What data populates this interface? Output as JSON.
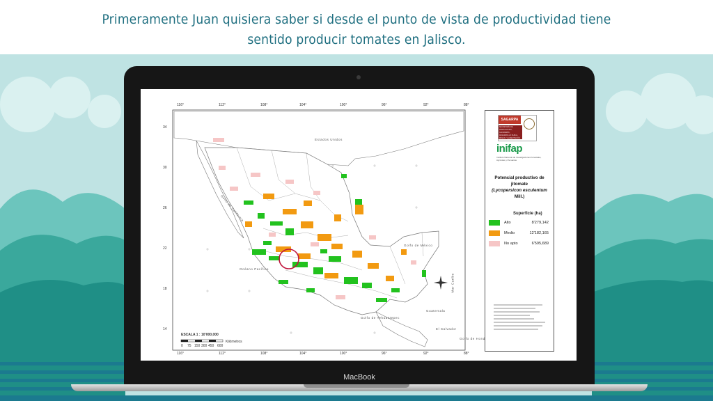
{
  "header": {
    "text": "Primeramente Juan quisiera saber si desde el punto de vista de productividad tiene sentido producir tomates en Jalisco."
  },
  "laptop": {
    "brand": "MacBook"
  },
  "map": {
    "longitudes": [
      "116°",
      "112°",
      "108°",
      "104°",
      "100°",
      "96°",
      "92°",
      "88°"
    ],
    "latitudes": [
      "34",
      "30",
      "26",
      "22",
      "18",
      "14"
    ],
    "labels": {
      "usa": "Estados Unidos",
      "gulf_mexico": "Golfo de México",
      "pacific": "Océano Pacífico",
      "gulf_tehuantepec": "Golfo de Tehuantepec",
      "gulf_california": "Golfo de California",
      "caribbean": "Mar Caribe",
      "guatemala": "Guatemala",
      "el_salvador": "El Salvador",
      "gulf_honduras": "Golfo de Honduras"
    },
    "scale_label": "ESCALA 1 : 10'000,000",
    "scale_ticks": [
      "0",
      "75",
      "150",
      "300",
      "450",
      "600"
    ],
    "scale_unit": "Kilómetros"
  },
  "panel": {
    "sagarpa": "SAGARPA",
    "sagarpa_sub": "SECRETARÍA DE AGRICULTURA, GANADERÍA, DESARROLLO RURAL, PESCA Y ALIMENTACIÓN",
    "inifap": "inifap",
    "inifap_sub": "Instituto Nacional de Investigaciones Forestales, Agrícolas y Pecuarias",
    "title_line1": "Potencial productivo de",
    "title_line2": "jitomate",
    "title_line3": "(Lycopersicon esculentum",
    "title_line4": "Mill.)",
    "superficie": "Superficie  (ha)",
    "legend": [
      {
        "label": "Alto",
        "value": "8'279,142",
        "color": "#22c21e"
      },
      {
        "label": "Medio",
        "value": "12'182,165",
        "color": "#f29a11"
      },
      {
        "label": "No apto",
        "value": "6'595,689",
        "color": "#f6c6c6"
      }
    ]
  },
  "colors": {
    "header_text": "#1f6f80",
    "sky": "#bfe3e3",
    "hills_dark": "#1f8f86",
    "hills_mid": "#3aa89c",
    "hills_light": "#6cc5bd",
    "stripes": "#1b7a8f",
    "highlight_circle": "#c0143c"
  }
}
